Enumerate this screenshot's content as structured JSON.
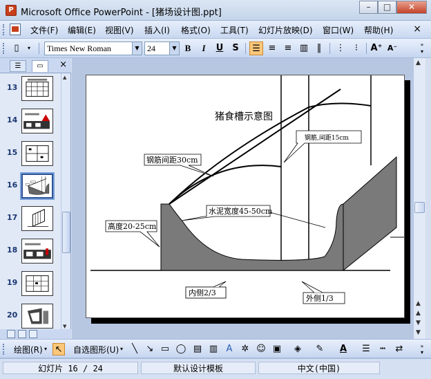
{
  "window": {
    "title": "Microsoft Office PowerPoint - [猪场设计图.ppt]",
    "icon": "powerpoint-icon",
    "buttons": [
      "minimize-icon",
      "maximize-icon",
      "close-icon"
    ]
  },
  "menu": {
    "items": [
      "文件(F)",
      "编辑(E)",
      "视图(V)",
      "插入(I)",
      "格式(O)",
      "工具(T)",
      "幻灯片放映(D)",
      "窗口(W)",
      "帮助(H)"
    ],
    "close": "×"
  },
  "toolbar": {
    "font_name": "Times New Roman",
    "font_size": "24",
    "bold": "B",
    "italic": "I",
    "underline": "U",
    "shadow": "S"
  },
  "slide_pane": {
    "slides": [
      {
        "number": "13"
      },
      {
        "number": "14"
      },
      {
        "number": "15"
      },
      {
        "number": "16",
        "selected": true
      },
      {
        "number": "17"
      },
      {
        "number": "18"
      },
      {
        "number": "19"
      },
      {
        "number": "20"
      }
    ],
    "close": "×"
  },
  "slide": {
    "title": "猪食槽示意图",
    "callouts": {
      "rebar_15": "钢筋,间距15cm",
      "rebar_30": "钢筋间距30cm",
      "cement_width": "水泥宽度45-50cm",
      "height": "高度20-25cm",
      "inner": "内侧2/3",
      "outer": "外侧1/3"
    }
  },
  "drawing_toolbar": {
    "draw": "绘图(R)",
    "autoshapes": "自选图形(U)"
  },
  "status": {
    "slide": "幻灯片 16 / 24",
    "template": "默认设计模板",
    "language": "中文(中国)"
  }
}
